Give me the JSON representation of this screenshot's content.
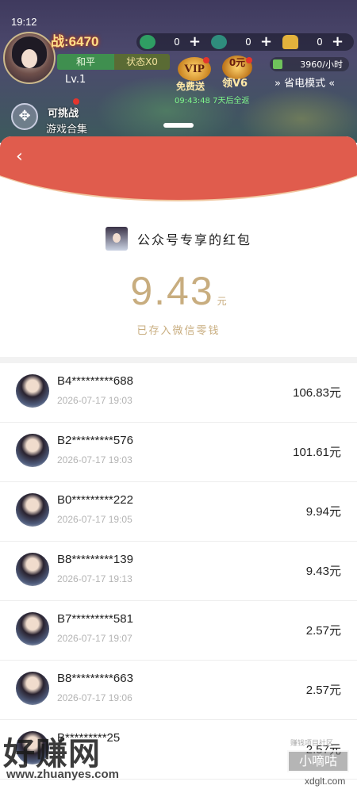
{
  "status_bar": {
    "time": "19:12"
  },
  "game_hud": {
    "power": "战:6470",
    "resources": [
      {
        "icon": "jade-icon",
        "value": "0"
      },
      {
        "icon": "bound-jade-icon",
        "value": "0"
      },
      {
        "icon": "gold-ingot-icon",
        "value": "0"
      }
    ],
    "peace_mode": "和平",
    "status": "状态X0",
    "level": "Lv.1",
    "vip_badge": "VIP",
    "vip_label": "免费送",
    "v6_badge_top": "0元",
    "v6_label": "领V6",
    "countdown": "09:43:48 7天后全返",
    "hourly_rate": "3960/小时",
    "power_save": "» 省电模式 «",
    "challenge": "可挑战",
    "game_collection": "游戏合集"
  },
  "red_packet": {
    "back_icon": "chevron-left-icon",
    "sender_name": "公众号专享的红包",
    "amount": "9.43",
    "amount_unit": "元",
    "saved_note": "已存入微信零钱",
    "header_color": "#e05c4d",
    "amount_color": "#c8ad7f",
    "records": [
      {
        "user": "B4*********688",
        "time": "2026-07-17  19:03",
        "amount": "106.83元"
      },
      {
        "user": "B2*********576",
        "time": "2026-07-17  19:03",
        "amount": "101.61元"
      },
      {
        "user": "B0*********222",
        "time": "2026-07-17  19:05",
        "amount": "9.94元"
      },
      {
        "user": "B8*********139",
        "time": "2026-07-17  19:13",
        "amount": "9.43元"
      },
      {
        "user": "B7*********581",
        "time": "2026-07-17  19:07",
        "amount": "2.57元"
      },
      {
        "user": "B8*********663",
        "time": "2026-07-17  19:06",
        "amount": "2.57元"
      },
      {
        "user": "B*********25",
        "time": "",
        "amount": "2.57元"
      }
    ]
  },
  "watermarks": {
    "left": "好赚网",
    "left_url": "www.zhuanyes.com",
    "right": "小嘀咕",
    "right_top": "赚钱项目社区",
    "right_url": "xdglt.com"
  }
}
